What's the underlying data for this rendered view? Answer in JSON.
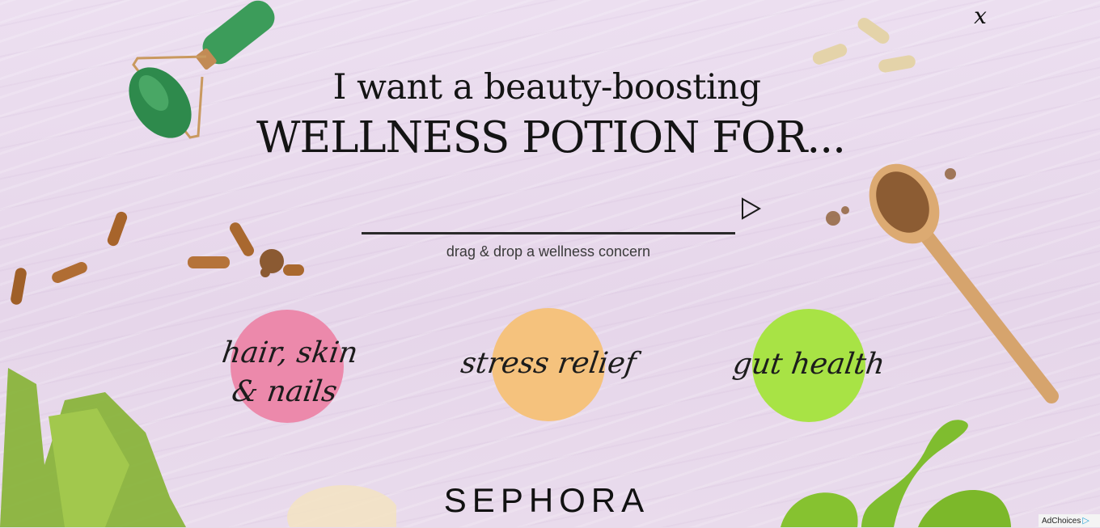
{
  "close": {
    "label": "x"
  },
  "headline": {
    "line1": "I want a beauty-boosting",
    "line2": "WELLNESS POTION FOR..."
  },
  "drop_zone": {
    "label": "drag & drop a wellness concern"
  },
  "concerns": [
    {
      "label": "hair, skin & nails",
      "color": "#ec89ab"
    },
    {
      "label": "stress relief",
      "color": "#f5c27d"
    },
    {
      "label": "gut health",
      "color": "#a8e345"
    }
  ],
  "brand": {
    "logo": "SEPHORA"
  },
  "ad": {
    "label": "AdChoices"
  },
  "icons": {
    "play": "play-icon",
    "close": "close-icon",
    "adchoices": "adchoices-icon"
  }
}
